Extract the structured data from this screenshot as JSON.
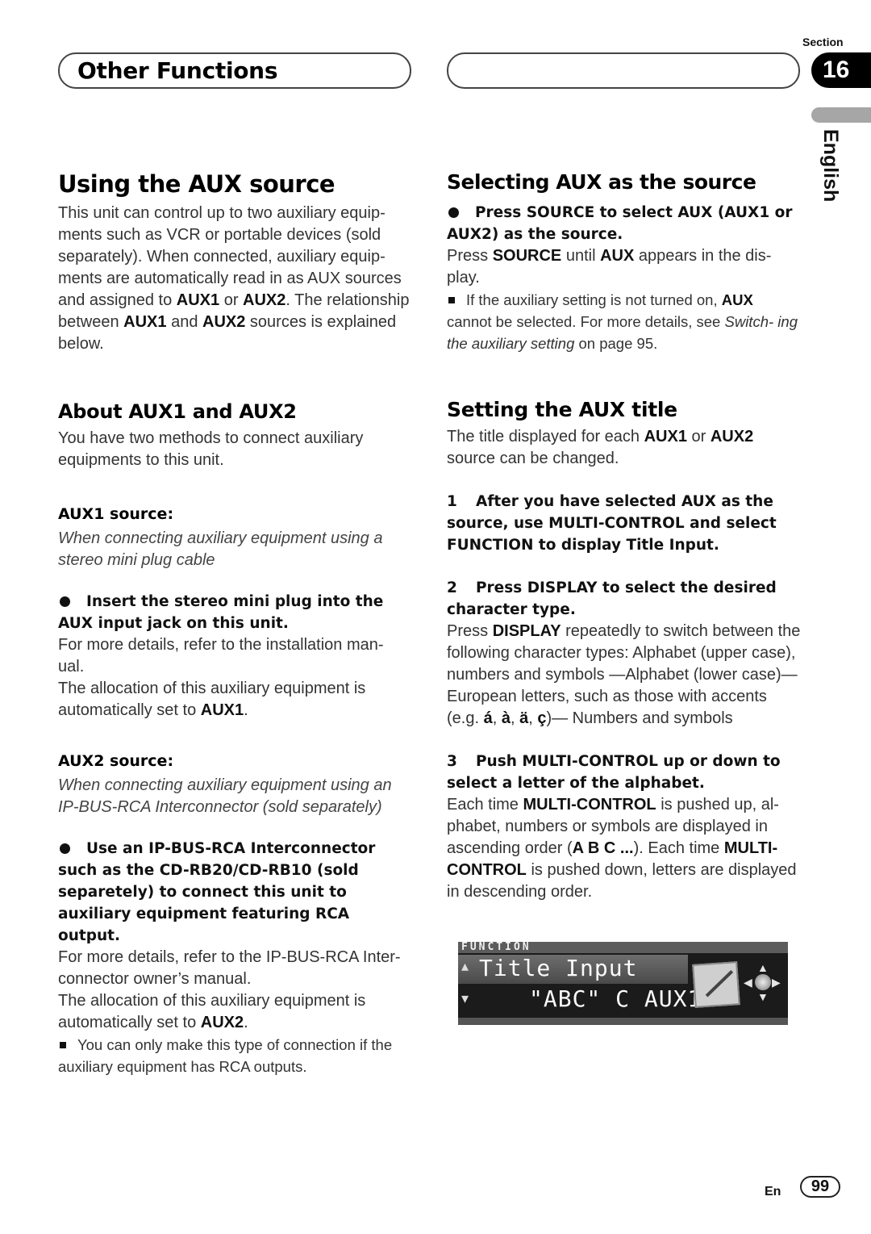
{
  "header": {
    "chapter_title": "Other Functions",
    "section_label": "Section",
    "section_number": "16",
    "language_tab": "English"
  },
  "left": {
    "title": "Using the AUX source",
    "intro": [
      {
        "t": "This unit can control up to two auxiliary equip- ments such as VCR or portable devices (sold separately). When connected, auxiliary equip- ments are automatically read in as AUX sources and assigned to "
      },
      {
        "b": "AUX1"
      },
      {
        "t": " or "
      },
      {
        "b": "AUX2"
      },
      {
        "t": ". The relationship between "
      },
      {
        "b": "AUX1"
      },
      {
        "t": " and "
      },
      {
        "b": "AUX2"
      },
      {
        "t": " sources is explained below."
      }
    ],
    "about_heading": "About AUX1 and AUX2",
    "about_text": "You have two methods to connect auxiliary equipments to this unit.",
    "aux1": {
      "heading": "AUX1 source:",
      "condition": "When connecting auxiliary equipment using a stereo mini plug cable",
      "step": "Insert the stereo mini plug into the AUX input jack on this unit.",
      "detail": "For more details, refer to the installation man- ual.",
      "allocation_prefix": "The allocation of this auxiliary equipment is automatically set to ",
      "allocation_value": "AUX1",
      "allocation_suffix": "."
    },
    "aux2": {
      "heading": "AUX2 source:",
      "condition": "When connecting auxiliary equipment using an IP-BUS-RCA Interconnector (sold separately)",
      "step": "Use an IP-BUS-RCA Interconnector such as the CD-RB20/CD-RB10 (sold separetely) to connect this unit to auxiliary equipment featuring RCA output.",
      "detail": "For more details, refer to the IP-BUS-RCA Inter- connector owner’s manual.",
      "allocation_prefix": "The allocation of this auxiliary equipment is automatically set to ",
      "allocation_value": "AUX2",
      "allocation_suffix": ".",
      "note": "You can only make this type of connection if the auxiliary equipment has RCA outputs."
    }
  },
  "right": {
    "select_heading": "Selecting AUX as the source",
    "select_step": "Press SOURCE to select AUX (AUX1 or AUX2) as the source.",
    "select_detail": [
      {
        "t": "Press "
      },
      {
        "b": "SOURCE"
      },
      {
        "t": " until "
      },
      {
        "b": "AUX"
      },
      {
        "t": " appears in the dis- play."
      }
    ],
    "select_note": [
      {
        "t": "If the auxiliary setting is not turned on, "
      },
      {
        "b": "AUX"
      },
      {
        "t": " cannot be selected. For more details, see "
      },
      {
        "i": "Switch- ing the auxiliary setting"
      },
      {
        "t": " on page 95."
      }
    ],
    "title_heading": "Setting the AUX title",
    "title_intro": [
      {
        "t": "The title displayed for each "
      },
      {
        "b": "AUX1"
      },
      {
        "t": " or "
      },
      {
        "b": "AUX2"
      },
      {
        "t": " source can be changed."
      }
    ],
    "steps": [
      {
        "num": "1",
        "text": "After you have selected AUX as the source, use MULTI-CONTROL and select FUNCTION to display Title Input.",
        "detail": []
      },
      {
        "num": "2",
        "text": "Press DISPLAY to select the desired character type.",
        "detail": [
          {
            "t": "Press "
          },
          {
            "b": "DISPLAY"
          },
          {
            "t": " repeatedly to switch between the following character types: Alphabet (upper case), numbers and symbols —Alphabet (lower case)—European letters, such as those with accents (e.g. "
          },
          {
            "b": "á"
          },
          {
            "t": ", "
          },
          {
            "b": "à"
          },
          {
            "t": ", "
          },
          {
            "b": "ä"
          },
          {
            "t": ", "
          },
          {
            "b": "ç"
          },
          {
            "t": ")— Numbers and symbols"
          }
        ]
      },
      {
        "num": "3",
        "text": "Push MULTI-CONTROL up or down to select a letter of the alphabet.",
        "detail": [
          {
            "t": "Each time "
          },
          {
            "b": "MULTI-CONTROL"
          },
          {
            "t": " is pushed up, al- phabet, numbers or symbols are displayed in ascending order ("
          },
          {
            "b": "A B C ..."
          },
          {
            "t": "). Each time "
          },
          {
            "b": "MULTI-CONTROL"
          },
          {
            "t": " is pushed down, letters are displayed in descending order."
          }
        ]
      }
    ],
    "display": {
      "menu_label": "FUNCTION",
      "item_label": "Title Input",
      "value": "\"ABC\" C AUX1"
    }
  },
  "footer": {
    "lang_code": "En",
    "page_number": "99"
  }
}
